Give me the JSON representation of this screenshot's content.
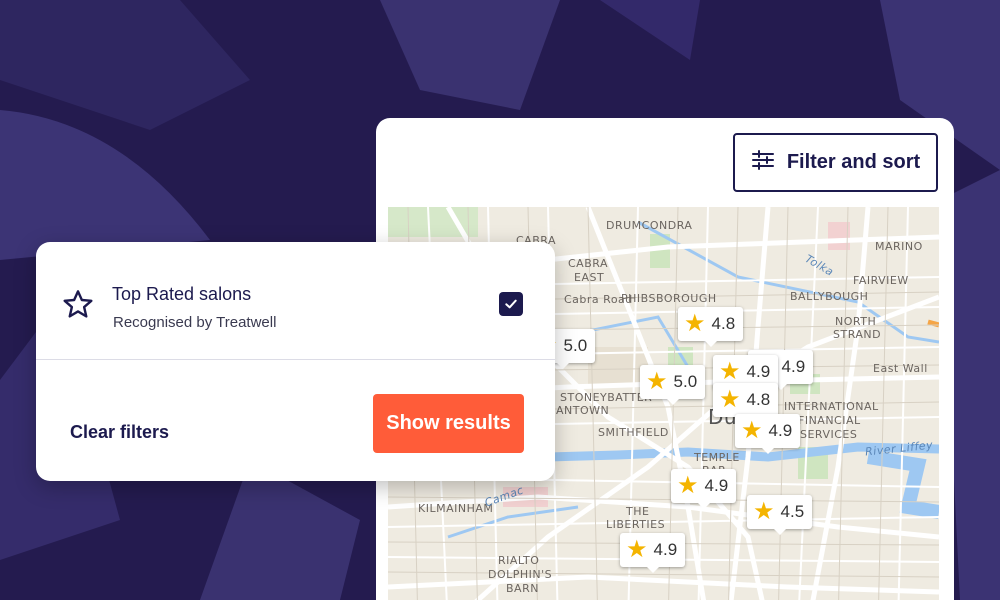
{
  "colors": {
    "background": "#241b4f",
    "navy": "#1c1a4e",
    "accent": "#ff5c39",
    "star": "#f4b400"
  },
  "toolbar": {
    "filter_label": "Filter and sort",
    "filter_icon": "sliders-icon"
  },
  "filter_panel": {
    "option": {
      "icon": "star-outline-icon",
      "title": "Top Rated salons",
      "subtitle": "Recognised by Treatwell",
      "checked": true
    },
    "clear_label": "Clear filters",
    "show_label": "Show results"
  },
  "map": {
    "labels": [
      "DRUMCONDRA",
      "MARINO",
      "CABRA",
      "CABRA",
      "EAST",
      "Cabra Road",
      "PHIBSBOROUGH",
      "BALLYBOUGH",
      "FAIRVIEW",
      "NORTH",
      "STRAND",
      "East Wall",
      "STONEYBATTER",
      "ANTOWN",
      "SMITHFIELD",
      "INTERNATIONAL",
      "FINANCIAL",
      "SERVICES",
      "TEMPLE",
      "BAR",
      "River Liffey",
      "KILMAINHAM",
      "THE",
      "LIBERTIES",
      "RIALTO",
      "DOLPHIN'S",
      "BARN",
      "Tolka",
      "Camac",
      "Du"
    ],
    "pins": [
      {
        "rating": "5.0"
      },
      {
        "rating": "4.8"
      },
      {
        "rating": "5.0"
      },
      {
        "rating": "4.9"
      },
      {
        "rating": "4.9"
      },
      {
        "rating": "4.8"
      },
      {
        "rating": "4.9"
      },
      {
        "rating": "4.9"
      },
      {
        "rating": "4.5"
      },
      {
        "rating": "4.9"
      }
    ]
  }
}
